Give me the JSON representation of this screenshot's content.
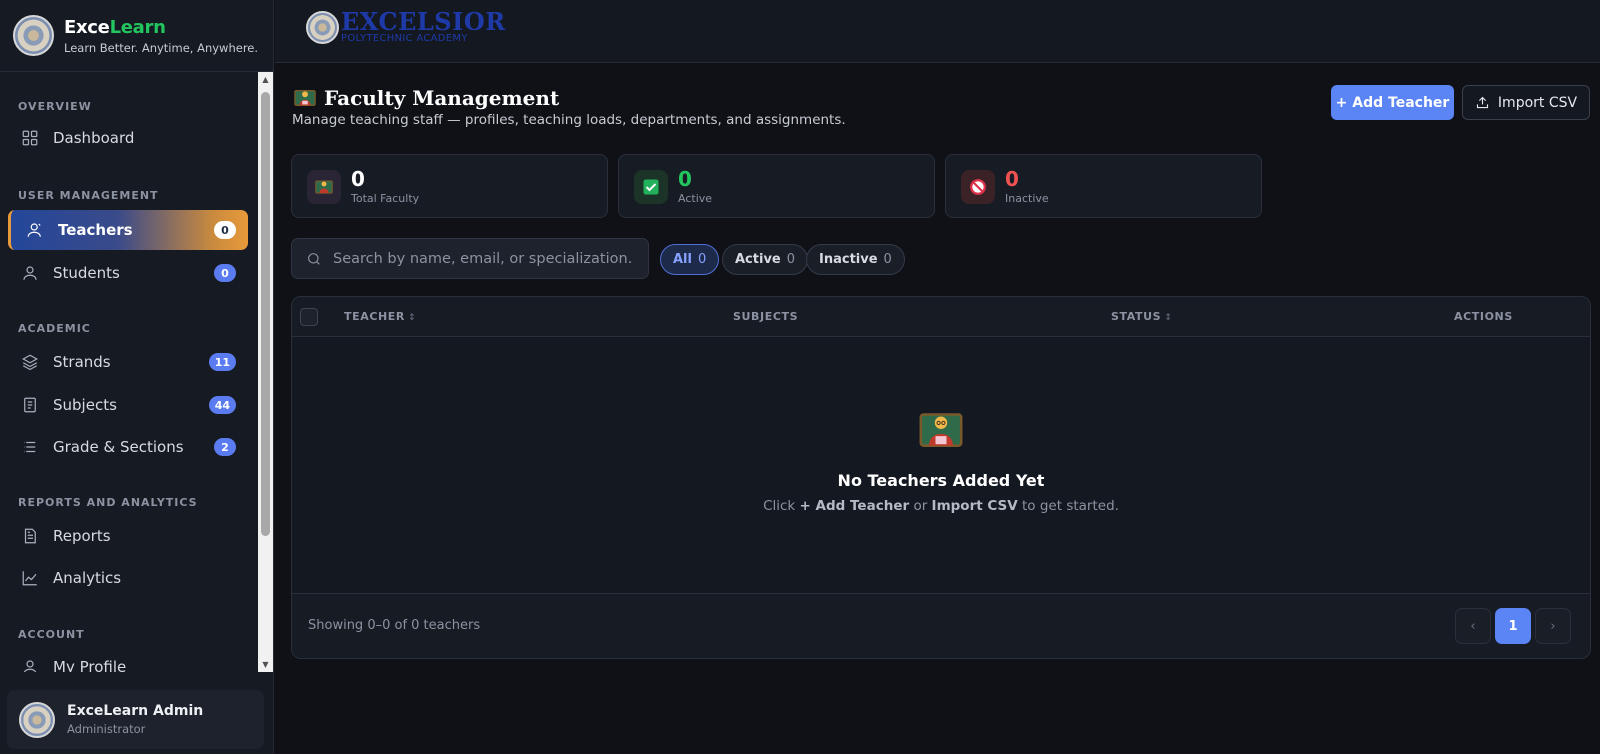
{
  "brand": {
    "name_part1": "Exce",
    "name_part2": "Learn",
    "tagline": "Learn Better. Anytime, Anywhere.",
    "accent_color": "#22c55e"
  },
  "sidebar": {
    "sections": {
      "overview": "OVERVIEW",
      "user_management": "USER MANAGEMENT",
      "academic": "ACADEMIC",
      "reports": "REPORTS AND ANALYTICS",
      "account": "ACCOUNT"
    },
    "items": {
      "dashboard": {
        "label": "Dashboard",
        "icon": "grid-icon"
      },
      "teachers": {
        "label": "Teachers",
        "badge": "0",
        "icon": "user-icon"
      },
      "students": {
        "label": "Students",
        "badge": "0",
        "icon": "user-icon"
      },
      "strands": {
        "label": "Strands",
        "badge": "11",
        "icon": "layers-icon"
      },
      "subjects": {
        "label": "Subjects",
        "badge": "44",
        "icon": "book-icon"
      },
      "grades": {
        "label": "Grade & Sections",
        "badge": "2",
        "icon": "list-icon"
      },
      "reports": {
        "label": "Reports",
        "icon": "document-icon"
      },
      "analytics": {
        "label": "Analytics",
        "icon": "chart-icon"
      },
      "profile": {
        "label": "My Profile",
        "icon": "user-icon"
      }
    }
  },
  "user": {
    "name": "ExceLearn Admin",
    "role": "Administrator"
  },
  "header": {
    "logo_title": "EXCELSIOR",
    "logo_subtitle": "POLYTECHNIC ACADEMY"
  },
  "page": {
    "title": "Faculty Management",
    "subtitle": "Manage teaching staff — profiles, teaching loads, departments, and assignments.",
    "add_button": "+ Add Teacher",
    "import_button": "Import CSV"
  },
  "stats": {
    "total": {
      "value": "0",
      "label": "Total Faculty",
      "color": "#ffffff"
    },
    "active": {
      "value": "0",
      "label": "Active",
      "color": "#22c55e"
    },
    "inactive": {
      "value": "0",
      "label": "Inactive",
      "color": "#f05252"
    }
  },
  "search": {
    "placeholder": "Search by name, email, or specialization..."
  },
  "filters": {
    "all": {
      "label": "All",
      "count": "0"
    },
    "active": {
      "label": "Active",
      "count": "0"
    },
    "inactive": {
      "label": "Inactive",
      "count": "0"
    }
  },
  "table": {
    "columns": {
      "teacher": "TEACHER",
      "subjects": "SUBJECTS",
      "status": "STATUS",
      "actions": "ACTIONS"
    },
    "sort_glyph": "↕",
    "empty_title": "No Teachers Added Yet",
    "empty_hint_pre": "Click",
    "empty_hint_add": "+ Add Teacher",
    "empty_hint_mid": "or",
    "empty_hint_import": "Import CSV",
    "empty_hint_post": "to get started."
  },
  "pagination": {
    "showing": "Showing 0–0 of 0 teachers",
    "prev": "‹",
    "current": "1",
    "next": "›"
  }
}
